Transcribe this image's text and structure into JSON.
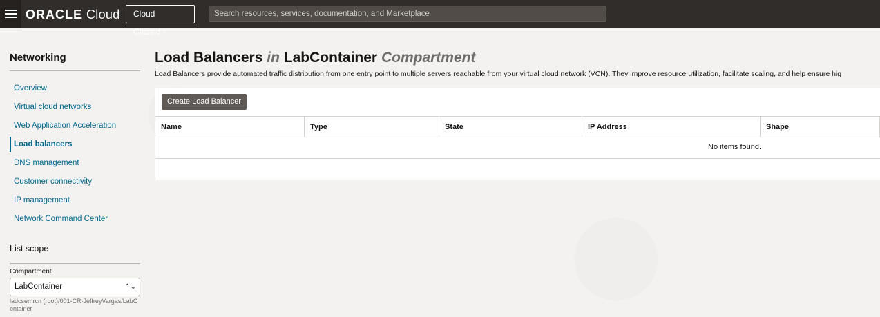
{
  "header": {
    "brand_oracle": "ORACLE",
    "brand_cloud": "Cloud",
    "classic_label": "Cloud Classic",
    "search_placeholder": "Search resources, services, documentation, and Marketplace"
  },
  "sidebar": {
    "title": "Networking",
    "items": [
      {
        "label": "Overview",
        "active": false
      },
      {
        "label": "Virtual cloud networks",
        "active": false
      },
      {
        "label": "Web Application Acceleration",
        "active": false
      },
      {
        "label": "Load balancers",
        "active": true
      },
      {
        "label": "DNS management",
        "active": false
      },
      {
        "label": "Customer connectivity",
        "active": false
      },
      {
        "label": "IP management",
        "active": false
      },
      {
        "label": "Network Command Center",
        "active": false
      }
    ],
    "scope_title": "List scope",
    "compartment_label": "Compartment",
    "compartment_value": "LabContainer",
    "compartment_path": "ladcsemrcn (root)/001-CR-JeffreyVargas/LabContainer"
  },
  "main": {
    "title_resource": "Load Balancers",
    "title_in": "in",
    "title_compartment": "LabContainer",
    "title_suffix": "Compartment",
    "description": "Load Balancers provide automated traffic distribution from one entry point to multiple servers reachable from your virtual cloud network (VCN). They improve resource utilization, facilitate scaling, and help ensure hig",
    "create_button": "Create Load Balancer",
    "columns": [
      "Name",
      "Type",
      "State",
      "IP Address",
      "Shape"
    ],
    "empty_message": "No items found."
  }
}
